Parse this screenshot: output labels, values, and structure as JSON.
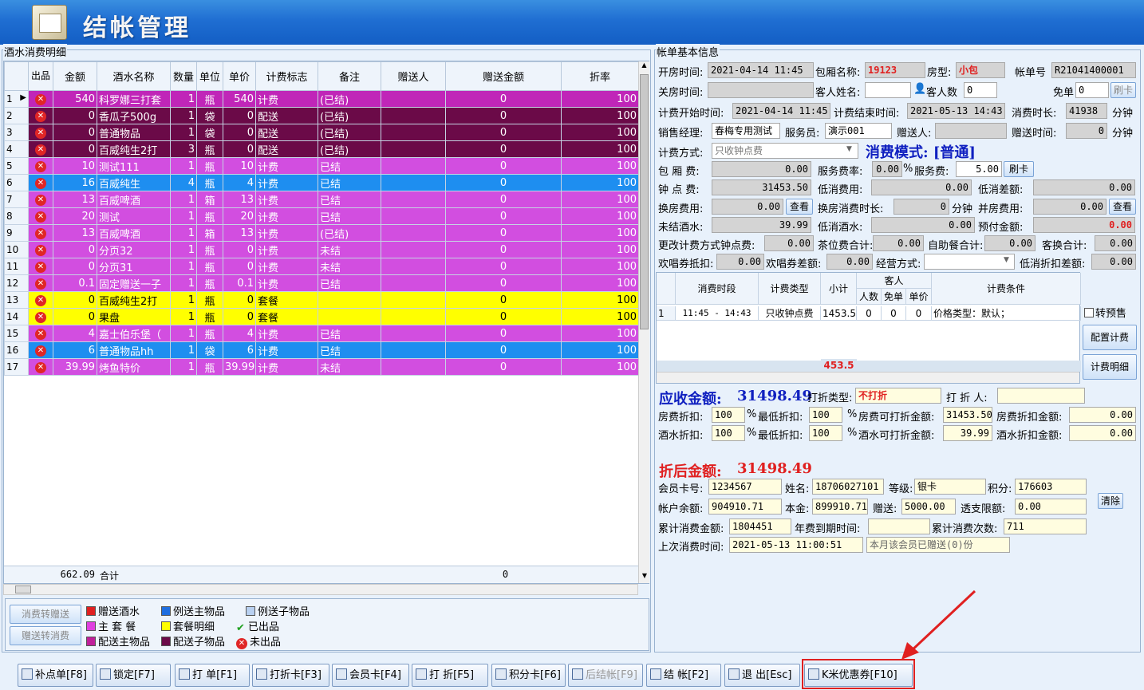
{
  "title": "结帐管理",
  "left": {
    "group_label": "酒水消费明细",
    "columns": [
      "出品",
      "金额",
      "酒水名称",
      "数量",
      "单位",
      "单价",
      "计费标志",
      "备注",
      "赠送人",
      "赠送金额",
      "折率"
    ],
    "rows": [
      {
        "n": "1",
        "amt": "540",
        "name": "科罗娜三打套",
        "qty": "1",
        "unit": "瓶",
        "price": "540",
        "flag": "计费",
        "note": "(已结)",
        "gift": "0",
        "rate": "100",
        "bg": "#c026b8",
        "fg": "#ffffff"
      },
      {
        "n": "2",
        "amt": "0",
        "name": "香瓜子500g",
        "qty": "1",
        "unit": "袋",
        "price": "0",
        "flag": "配送",
        "note": "(已结)",
        "gift": "0",
        "rate": "100",
        "bg": "#6b0a48",
        "fg": "#ffffff"
      },
      {
        "n": "3",
        "amt": "0",
        "name": "普通物品",
        "qty": "1",
        "unit": "袋",
        "price": "0",
        "flag": "配送",
        "note": "(已结)",
        "gift": "0",
        "rate": "100",
        "bg": "#6b0a48",
        "fg": "#ffffff"
      },
      {
        "n": "4",
        "amt": "0",
        "name": "百威纯生2打",
        "qty": "3",
        "unit": "瓶",
        "price": "0",
        "flag": "配送",
        "note": "(已结)",
        "gift": "0",
        "rate": "100",
        "bg": "#6b0a48",
        "fg": "#ffffff"
      },
      {
        "n": "5",
        "amt": "10",
        "name": "测试111",
        "qty": "1",
        "unit": "瓶",
        "price": "10",
        "flag": "计费",
        "note": "已结",
        "gift": "0",
        "rate": "100",
        "bg": "#d24ee0",
        "fg": "#ffffff"
      },
      {
        "n": "6",
        "amt": "16",
        "name": "百威纯生",
        "qty": "4",
        "unit": "瓶",
        "price": "4",
        "flag": "计费",
        "note": "已结",
        "gift": "0",
        "rate": "100",
        "bg": "#1e8ef0",
        "fg": "#ffffff"
      },
      {
        "n": "7",
        "amt": "13",
        "name": "百威啤酒",
        "qty": "1",
        "unit": "箱",
        "price": "13",
        "flag": "计费",
        "note": "已结",
        "gift": "0",
        "rate": "100",
        "bg": "#d24ee0",
        "fg": "#ffffff"
      },
      {
        "n": "8",
        "amt": "20",
        "name": "测试",
        "qty": "1",
        "unit": "瓶",
        "price": "20",
        "flag": "计费",
        "note": "已结",
        "gift": "0",
        "rate": "100",
        "bg": "#d24ee0",
        "fg": "#ffffff"
      },
      {
        "n": "9",
        "amt": "13",
        "name": "百威啤酒",
        "qty": "1",
        "unit": "箱",
        "price": "13",
        "flag": "计费",
        "note": "(已结)",
        "gift": "0",
        "rate": "100",
        "bg": "#d24ee0",
        "fg": "#ffffff"
      },
      {
        "n": "10",
        "amt": "0",
        "name": "分页32",
        "qty": "1",
        "unit": "瓶",
        "price": "0",
        "flag": "计费",
        "note": "未结",
        "gift": "0",
        "rate": "100",
        "bg": "#d24ee0",
        "fg": "#ffffff"
      },
      {
        "n": "11",
        "amt": "0",
        "name": "分页31",
        "qty": "1",
        "unit": "瓶",
        "price": "0",
        "flag": "计费",
        "note": "未结",
        "gift": "0",
        "rate": "100",
        "bg": "#d24ee0",
        "fg": "#ffffff"
      },
      {
        "n": "12",
        "amt": "0.1",
        "name": "固定赠送一子",
        "qty": "1",
        "unit": "瓶",
        "price": "0.1",
        "flag": "计费",
        "note": "已结",
        "gift": "0",
        "rate": "100",
        "bg": "#d24ee0",
        "fg": "#ffffff"
      },
      {
        "n": "13",
        "amt": "0",
        "name": "百威纯生2打",
        "qty": "1",
        "unit": "瓶",
        "price": "0",
        "flag": "套餐",
        "note": "",
        "gift": "0",
        "rate": "100",
        "bg": "#ffff00",
        "fg": "#000000"
      },
      {
        "n": "14",
        "amt": "0",
        "name": "果盘",
        "qty": "1",
        "unit": "瓶",
        "price": "0",
        "flag": "套餐",
        "note": "",
        "gift": "0",
        "rate": "100",
        "bg": "#ffff00",
        "fg": "#000000"
      },
      {
        "n": "15",
        "amt": "4",
        "name": "嘉士伯乐堡（",
        "qty": "1",
        "unit": "瓶",
        "price": "4",
        "flag": "计费",
        "note": "已结",
        "gift": "0",
        "rate": "100",
        "bg": "#d24ee0",
        "fg": "#ffffff"
      },
      {
        "n": "16",
        "amt": "6",
        "name": "普通物品hh",
        "qty": "1",
        "unit": "袋",
        "price": "6",
        "flag": "计费",
        "note": "已结",
        "gift": "0",
        "rate": "100",
        "bg": "#1e8ef0",
        "fg": "#ffffff"
      },
      {
        "n": "17",
        "amt": "39.99",
        "name": "烤鱼特价",
        "qty": "1",
        "unit": "瓶",
        "price": "39.99",
        "flag": "计费",
        "note": "未结",
        "gift": "0",
        "rate": "100",
        "bg": "#d24ee0",
        "fg": "#ffffff"
      }
    ],
    "footer": {
      "amt": "662.09",
      "name": "合计",
      "gift": "0"
    },
    "side_buttons": [
      "消费转赠送",
      "赠送转消费"
    ],
    "legend": [
      {
        "label": "赠送酒水",
        "color": "#e02020"
      },
      {
        "label": "例送主物品",
        "color": "#1e6ee0"
      },
      {
        "label": "例送子物品",
        "color": "#b8d0f0"
      },
      {
        "label": "主 套 餐",
        "color": "#e040e0"
      },
      {
        "label": "套餐明细",
        "color": "#ffff00"
      },
      {
        "label": "已出品",
        "color": "#20a020"
      },
      {
        "label": "配送主物品",
        "color": "#c0209a"
      },
      {
        "label": "配送子物品",
        "color": "#6b0a48"
      },
      {
        "label": "未出品",
        "color": "#e02626"
      }
    ]
  },
  "right": {
    "group_label": "帐单基本信息",
    "open_time_label": "开房时间:",
    "open_time": "2021-04-14 11:45",
    "room_name_label": "包厢名称:",
    "room_name": "19123",
    "room_type_label": "房型:",
    "room_type": "小包",
    "bill_no_label": "帐单号",
    "bill_no": "R21041400001",
    "close_time_label": "关房时间:",
    "close_time": "",
    "guest_name_label": "客人姓名:",
    "guest_name": "",
    "guest_count_label": "客人数",
    "guest_count": "0",
    "free_order_label": "免单",
    "free_order": "0",
    "swipe_label": "刷卡",
    "bill_start_label": "计费开始时间:",
    "bill_start": "2021-04-14 11:45",
    "bill_end_label": "计费结束时间:",
    "bill_end": "2021-05-13 14:43",
    "duration_label": "消费时长:",
    "duration": "41938",
    "minutes": "分钟",
    "manager_label": "销售经理:",
    "manager": "春梅专用测试",
    "waiter_label": "服务员:",
    "waiter": "演示001",
    "giver_label": "赠送人:",
    "giver": "",
    "gift_time_label": "赠送时间:",
    "gift_time": "0",
    "billing_mode_label": "计费方式:",
    "billing_mode": "只收钟点费",
    "consume_mode": "消费模式: [普通]",
    "room_fee_label": "包 厢 费:",
    "room_fee": "0.00",
    "service_rate_label": "服务费率:",
    "service_rate": "0.00",
    "pct": "%",
    "service_fee_label": "服务费:",
    "service_fee": "5.00",
    "swipe2": "刷卡",
    "hour_fee_label": "钟 点 费:",
    "hour_fee": "31453.50",
    "min_fee_label": "低消费用:",
    "min_fee": "0.00",
    "min_diff_label": "低消差额:",
    "min_diff": "0.00",
    "change_fee_label": "换房费用:",
    "change_fee": "0.00",
    "view": "查看",
    "change_dur_label": "换房消费时长:",
    "change_dur": "0",
    "merge_fee_label": "并房费用:",
    "merge_fee": "0.00",
    "unsettled_label": "未结酒水:",
    "unsettled": "39.99",
    "min_drink_label": "低消酒水:",
    "min_drink": "0.00",
    "prepaid_label": "预付金额:",
    "prepaid": "0.00",
    "change_mode_label": "更改计费方式钟点费:",
    "change_mode": "0.00",
    "tea_label": "茶位费合计:",
    "tea": "0.00",
    "buffet_label": "自助餐合计:",
    "buffet": "0.00",
    "swap_label": "客换合计:",
    "swap": "0.00",
    "coupon_label": "欢唱券抵扣:",
    "coupon": "0.00",
    "coupon_diff_label": "欢唱券差额:",
    "coupon_diff": "0.00",
    "biz_mode_label": "经营方式:",
    "biz_mode": "",
    "min_disc_label": "低消折扣差额:",
    "min_disc": "0.00",
    "seg_cols": [
      "消费时段",
      "计费类型",
      "小计",
      "客人",
      "人数",
      "免单",
      "单价",
      "计费条件"
    ],
    "seg_row": {
      "n": "1",
      "period": "11:45 - 14:43",
      "type": "只收钟点费",
      "subtotal": "1453.5",
      "people": "0",
      "free": "0",
      "price": "0",
      "cond": "价格类型：默认；"
    },
    "seg_total": "453.5",
    "to_presale": "转预售",
    "config_btn": "配置计费",
    "detail_btn": "计费明细",
    "receivable_label": "应收金额:",
    "receivable": "31498.49",
    "disc_type_label": "打折类型:",
    "disc_type": "不打折",
    "disc_person_label": "打 折 人:",
    "disc_person": "",
    "room_disc_label": "房费折扣:",
    "room_disc": "100",
    "min_room_disc_label": "最低折扣:",
    "min_room_disc": "100",
    "room_disc_amt_label": "房费可打折金额:",
    "room_disc_amt": "31453.50",
    "room_disc_val_label": "房费折扣金额:",
    "room_disc_val": "0.00",
    "drink_disc_label": "酒水折扣:",
    "drink_disc": "100",
    "min_drink_disc_label": "最低折扣:",
    "min_drink_disc": "100",
    "drink_disc_amt_label": "酒水可打折金额:",
    "drink_disc_amt": "39.99",
    "drink_disc_val_label": "酒水折扣金额:",
    "drink_disc_val": "0.00",
    "after_label": "折后金额:",
    "after": "31498.49",
    "card_label": "会员卡号:",
    "card": "1234567",
    "name_label": "姓名:",
    "name": "18706027101",
    "level_label": "等级:",
    "level": "银卡",
    "points_label": "积分:",
    "points": "176603",
    "clear": "清除",
    "balance_label": "帐户余额:",
    "balance": "904910.71",
    "principal_label": "本金:",
    "principal": "899910.71",
    "gifted_label": "赠送:",
    "gifted": "5000.00",
    "overdraft_label": "透支限额:",
    "overdraft": "0.00",
    "total_spent_label": "累计消费金额:",
    "total_spent": "1804451",
    "annual_label": "年费到期时间:",
    "annual": "",
    "visits_label": "累计消费次数:",
    "visits": "711",
    "last_visit_label": "上次消费时间:",
    "last_visit": "2021-05-13 11:00:51",
    "month_note": "本月该会员已赠送(0)份"
  },
  "buttons": [
    {
      "label": "补点单[F8]",
      "icon": "add-order-icon"
    },
    {
      "label": "锁定[F7]",
      "icon": "lock-icon"
    },
    {
      "label": "打 单[F1]",
      "icon": "printer-icon"
    },
    {
      "label": "打折卡[F3]",
      "icon": "card-icon"
    },
    {
      "label": "会员卡[F4]",
      "icon": "member-icon"
    },
    {
      "label": "打 折[F5]",
      "icon": "discount-icon"
    },
    {
      "label": "积分卡[F6]",
      "icon": "points-icon"
    },
    {
      "label": "后结帐[F9]",
      "icon": "later-icon"
    },
    {
      "label": "结 帐[F2]",
      "icon": "checkout-icon"
    },
    {
      "label": "退 出[Esc]",
      "icon": "exit-icon"
    },
    {
      "label": "K米优惠券[F10]",
      "icon": "coupon-icon"
    }
  ],
  "accent_red": "#e02020"
}
